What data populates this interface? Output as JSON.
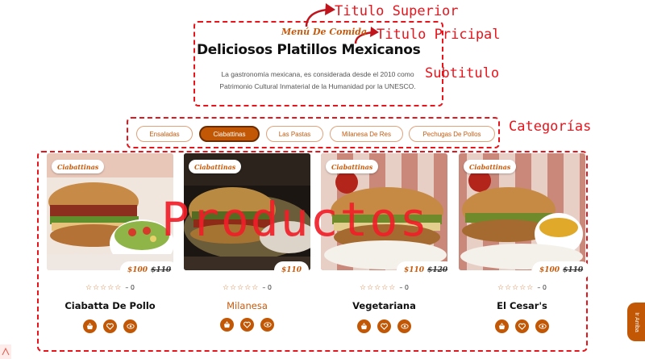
{
  "annotations": {
    "titulo_superior": "Titulo Superior",
    "titulo_principal": "Titulo Pricipal",
    "subtitulo": "Subtitulo",
    "categorias": "Categorías",
    "productos": "Productos"
  },
  "header": {
    "sup_title": "Menú De Comida",
    "main_title": "Deliciosos Platillos Mexicanos",
    "subtitle": "La gastronomía mexicana, es considerada desde el 2010 como Patrimonio Cultural Inmaterial de la Humanidad por la UNESCO."
  },
  "categories": [
    {
      "label": "Ensaladas",
      "active": false
    },
    {
      "label": "Ciabattinas",
      "active": true
    },
    {
      "label": "Las Pastas",
      "active": false
    },
    {
      "label": "Milanesa De Res",
      "active": false
    },
    {
      "label": "Pechugas De Pollos",
      "active": false
    }
  ],
  "products": [
    {
      "badge": "Ciabattinas",
      "price": "$100",
      "old_price": "$110",
      "rating_count": "0",
      "name": "Ciabatta De Pollo",
      "highlight": false
    },
    {
      "badge": "Ciabattinas",
      "price": "$110",
      "old_price": "",
      "rating_count": "0",
      "name": "Milanesa",
      "highlight": true
    },
    {
      "badge": "Ciabattinas",
      "price": "$110",
      "old_price": "$120",
      "rating_count": "0",
      "name": "Vegetariana",
      "highlight": false
    },
    {
      "badge": "Ciabattinas",
      "price": "$100",
      "old_price": "$110",
      "rating_count": "0",
      "name": "El Cesar's",
      "highlight": false
    }
  ],
  "scroll_up_label": "Ir Arriba",
  "colors": {
    "accent": "#c25806",
    "annotation": "#e8141c"
  }
}
